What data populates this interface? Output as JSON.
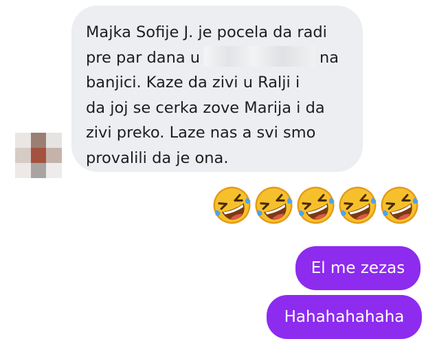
{
  "incoming_message": {
    "lines": [
      {
        "before": "Majka Sofije J. je pocela da radi",
        "after": ""
      },
      {
        "before": "pre par dana u",
        "after": "na"
      },
      {
        "before": "banjici.  Kaze da zivi u Ralji i",
        "after": ""
      },
      {
        "before": "da joj se cerka zove Marija i da",
        "after": ""
      },
      {
        "before": "zivi preko. Laze nas a svi smo",
        "after": ""
      },
      {
        "before": "provalili da je ona.",
        "after": ""
      }
    ]
  },
  "reaction": {
    "emoji_name": "rolling-on-the-floor-laughing",
    "count": 5,
    "colors": {
      "face": "#f6c02c",
      "face_edge": "#e39a16",
      "tear": "#4fa3e8",
      "mouth": "#7a3b12"
    }
  },
  "outgoing_messages": [
    {
      "text": "El me zezas"
    },
    {
      "text": "Hahahahahaha"
    }
  ],
  "colors": {
    "incoming_bubble": "#eceef1",
    "outgoing_bubble": "#8d2bee",
    "incoming_text": "#1c1e21",
    "outgoing_text": "#ffffff"
  }
}
